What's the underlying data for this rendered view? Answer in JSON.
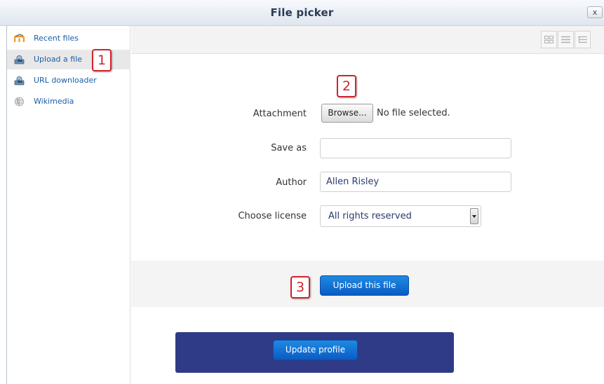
{
  "window": {
    "title": "File picker",
    "close_label": "x"
  },
  "sidebar": {
    "items": [
      {
        "label": "Recent files",
        "icon": "moodle-logo-icon",
        "active": false
      },
      {
        "label": "Upload a file",
        "icon": "upload-icon",
        "active": true
      },
      {
        "label": "URL downloader",
        "icon": "download-icon",
        "active": false
      },
      {
        "label": "Wikimedia",
        "icon": "wikimedia-globe-icon",
        "active": false
      }
    ]
  },
  "toolbar": {
    "views": [
      "icon-view",
      "list-view",
      "tree-view"
    ]
  },
  "form": {
    "attachment_label": "Attachment",
    "browse_label": "Browse...",
    "no_file_text": "No file selected.",
    "save_as_label": "Save as",
    "save_as_value": "",
    "author_label": "Author",
    "author_value": "Allen Risley",
    "license_label": "Choose license",
    "license_value": "All rights reserved"
  },
  "upload_button": "Upload this file",
  "profile_button": "Update profile",
  "callouts": {
    "step1": "1",
    "step2": "2",
    "step3": "3"
  },
  "colors": {
    "primary_button": "#0a5cc4",
    "callout_border": "#d2232a",
    "profile_panel": "#2f3b86",
    "link": "#1a5ea7"
  }
}
